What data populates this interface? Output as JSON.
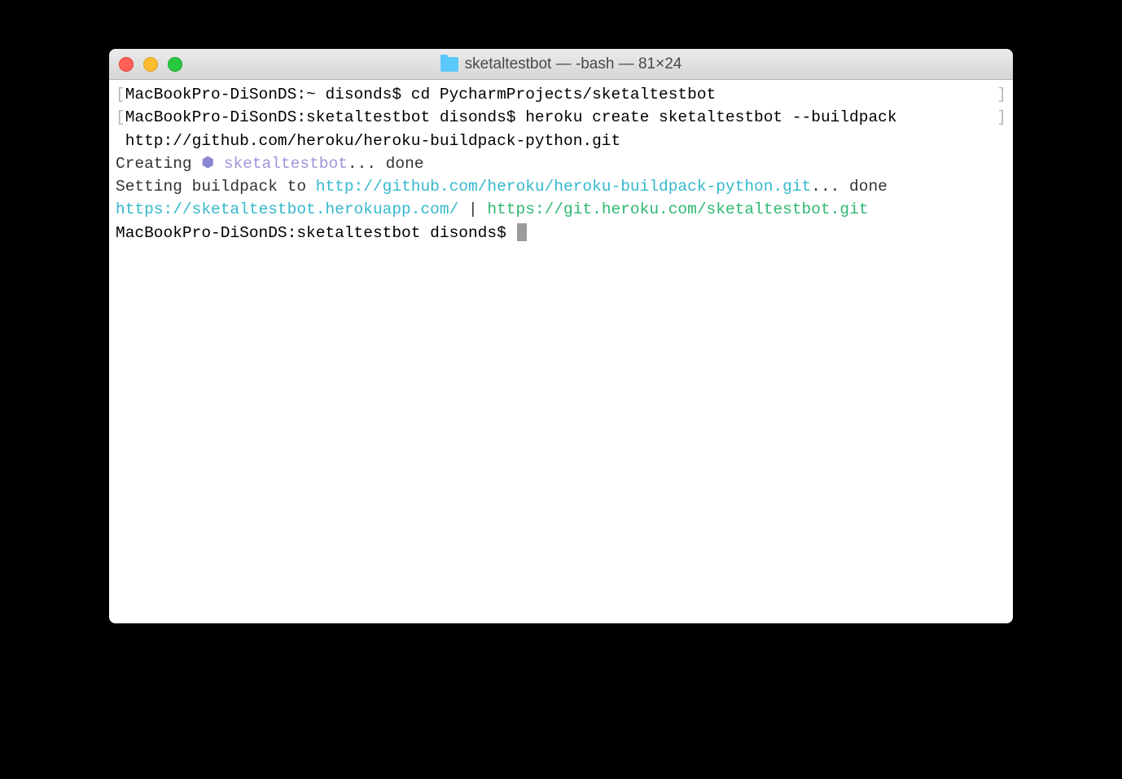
{
  "window": {
    "title": "sketaltestbot — -bash — 81×24"
  },
  "terminal": {
    "lines": [
      {
        "prompt": "MacBookPro-DiSonDS:~ disonds$",
        "command": "cd PycharmProjects/sketaltestbot"
      },
      {
        "prompt": "MacBookPro-DiSonDS:sketaltestbot disonds$",
        "command": "heroku create sketaltestbot --buildpack"
      },
      {
        "continuation": " http://github.com/heroku/heroku-buildpack-python.git"
      },
      {
        "creating_prefix": "Creating ",
        "app_name": "sketaltestbot",
        "creating_suffix": "... done"
      },
      {
        "setting_prefix": "Setting buildpack to ",
        "buildpack_url": "http://github.com/heroku/heroku-buildpack-python.git",
        "setting_suffix": "... done"
      },
      {
        "app_url": "https://sketaltestbot.herokuapp.com/",
        "separator": " | ",
        "git_url": "https://git.heroku.com/sketaltestbot.git"
      },
      {
        "prompt": "MacBookPro-DiSonDS:sketaltestbot disonds$"
      }
    ],
    "bracket_left": "[",
    "bracket_right": "]"
  }
}
